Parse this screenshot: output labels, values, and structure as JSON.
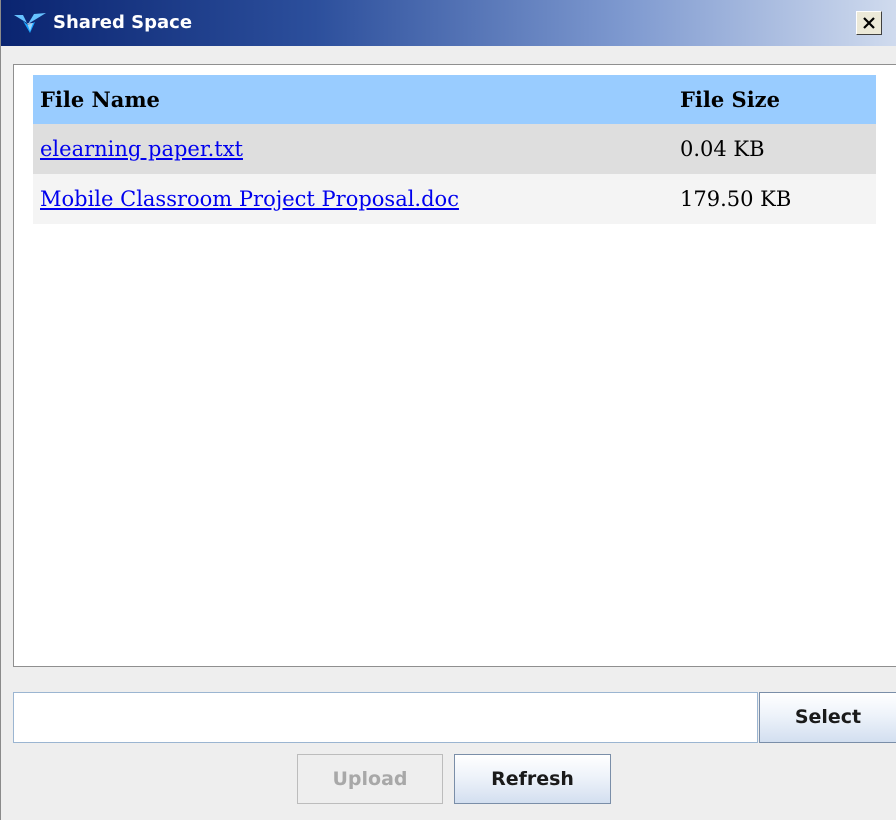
{
  "window": {
    "title": "Shared Space",
    "close_icon": "close-x-icon",
    "app_icon": "shared-space-bird-icon"
  },
  "table": {
    "headers": {
      "name": "File Name",
      "size": "File Size"
    },
    "rows": [
      {
        "name": "elearning paper.txt",
        "size": "0.04 KB"
      },
      {
        "name": "Mobile Classroom Project Proposal.doc",
        "size": "179.50 KB"
      }
    ]
  },
  "footer": {
    "path_value": "",
    "select_label": "Select",
    "upload_label": "Upload",
    "refresh_label": "Refresh"
  },
  "colors": {
    "header_bg": "#99ccff",
    "link": "#0000ee",
    "title_gradient_start": "#0a2470"
  }
}
